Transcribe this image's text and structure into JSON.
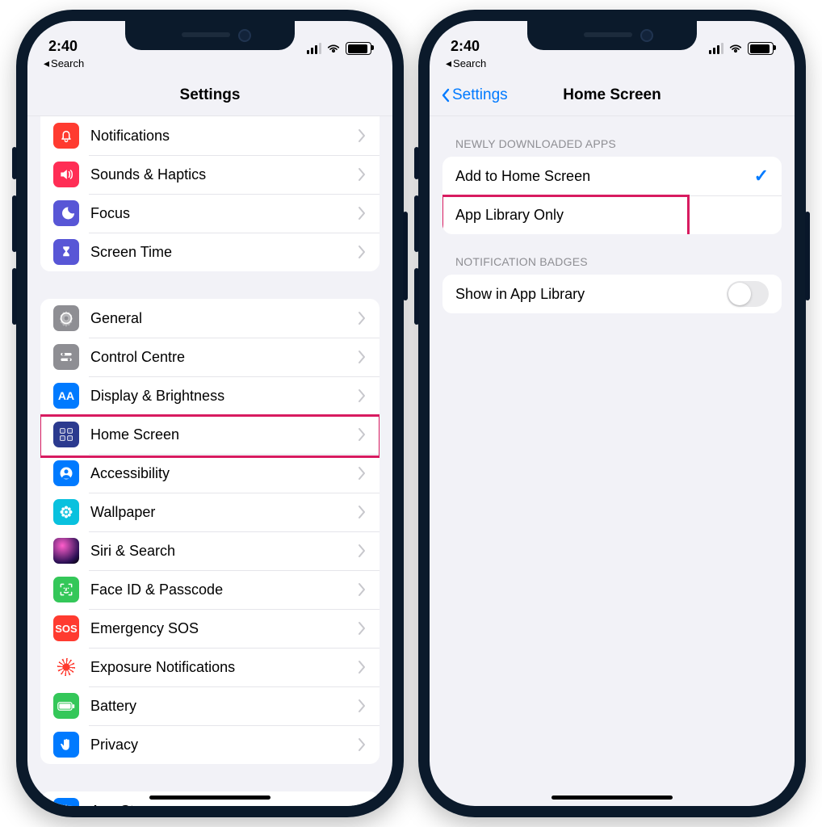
{
  "status": {
    "time": "2:40",
    "signal_bars": 3
  },
  "breadcrumb": {
    "label": "Search"
  },
  "left": {
    "nav_title": "Settings",
    "groups": [
      {
        "rows": [
          {
            "icon": "notifications",
            "glyph": "bell",
            "label": "Notifications"
          },
          {
            "icon": "sounds",
            "glyph": "speaker",
            "label": "Sounds & Haptics"
          },
          {
            "icon": "focus",
            "glyph": "moon",
            "label": "Focus"
          },
          {
            "icon": "screentime",
            "glyph": "hourglass",
            "label": "Screen Time"
          }
        ]
      },
      {
        "rows": [
          {
            "icon": "general",
            "glyph": "gear",
            "label": "General"
          },
          {
            "icon": "control",
            "glyph": "switches",
            "label": "Control Centre"
          },
          {
            "icon": "display",
            "glyph": "AA",
            "label": "Display & Brightness"
          },
          {
            "icon": "home",
            "glyph": "grid",
            "label": "Home Screen",
            "highlight": true
          },
          {
            "icon": "access",
            "glyph": "person",
            "label": "Accessibility"
          },
          {
            "icon": "wallpaper",
            "glyph": "flower",
            "label": "Wallpaper"
          },
          {
            "icon": "siri",
            "glyph": "",
            "label": "Siri & Search"
          },
          {
            "icon": "faceid",
            "glyph": "face",
            "label": "Face ID & Passcode"
          },
          {
            "icon": "sos",
            "glyph": "SOS",
            "label": "Emergency SOS"
          },
          {
            "icon": "exposure",
            "glyph": "",
            "label": "Exposure Notifications"
          },
          {
            "icon": "battery",
            "glyph": "battery",
            "label": "Battery"
          },
          {
            "icon": "privacy",
            "glyph": "hand",
            "label": "Privacy"
          }
        ]
      },
      {
        "rows": [
          {
            "icon": "appstore",
            "glyph": "appstore",
            "label": "App Store"
          }
        ]
      }
    ]
  },
  "right": {
    "back_label": "Settings",
    "nav_title": "Home Screen",
    "section1_header": "NEWLY DOWNLOADED APPS",
    "section1_rows": [
      {
        "label": "Add to Home Screen",
        "selected": true
      },
      {
        "label": "App Library Only",
        "selected": false,
        "highlight": true
      }
    ],
    "section2_header": "NOTIFICATION BADGES",
    "section2_row": {
      "label": "Show in App Library",
      "toggle": false
    }
  }
}
